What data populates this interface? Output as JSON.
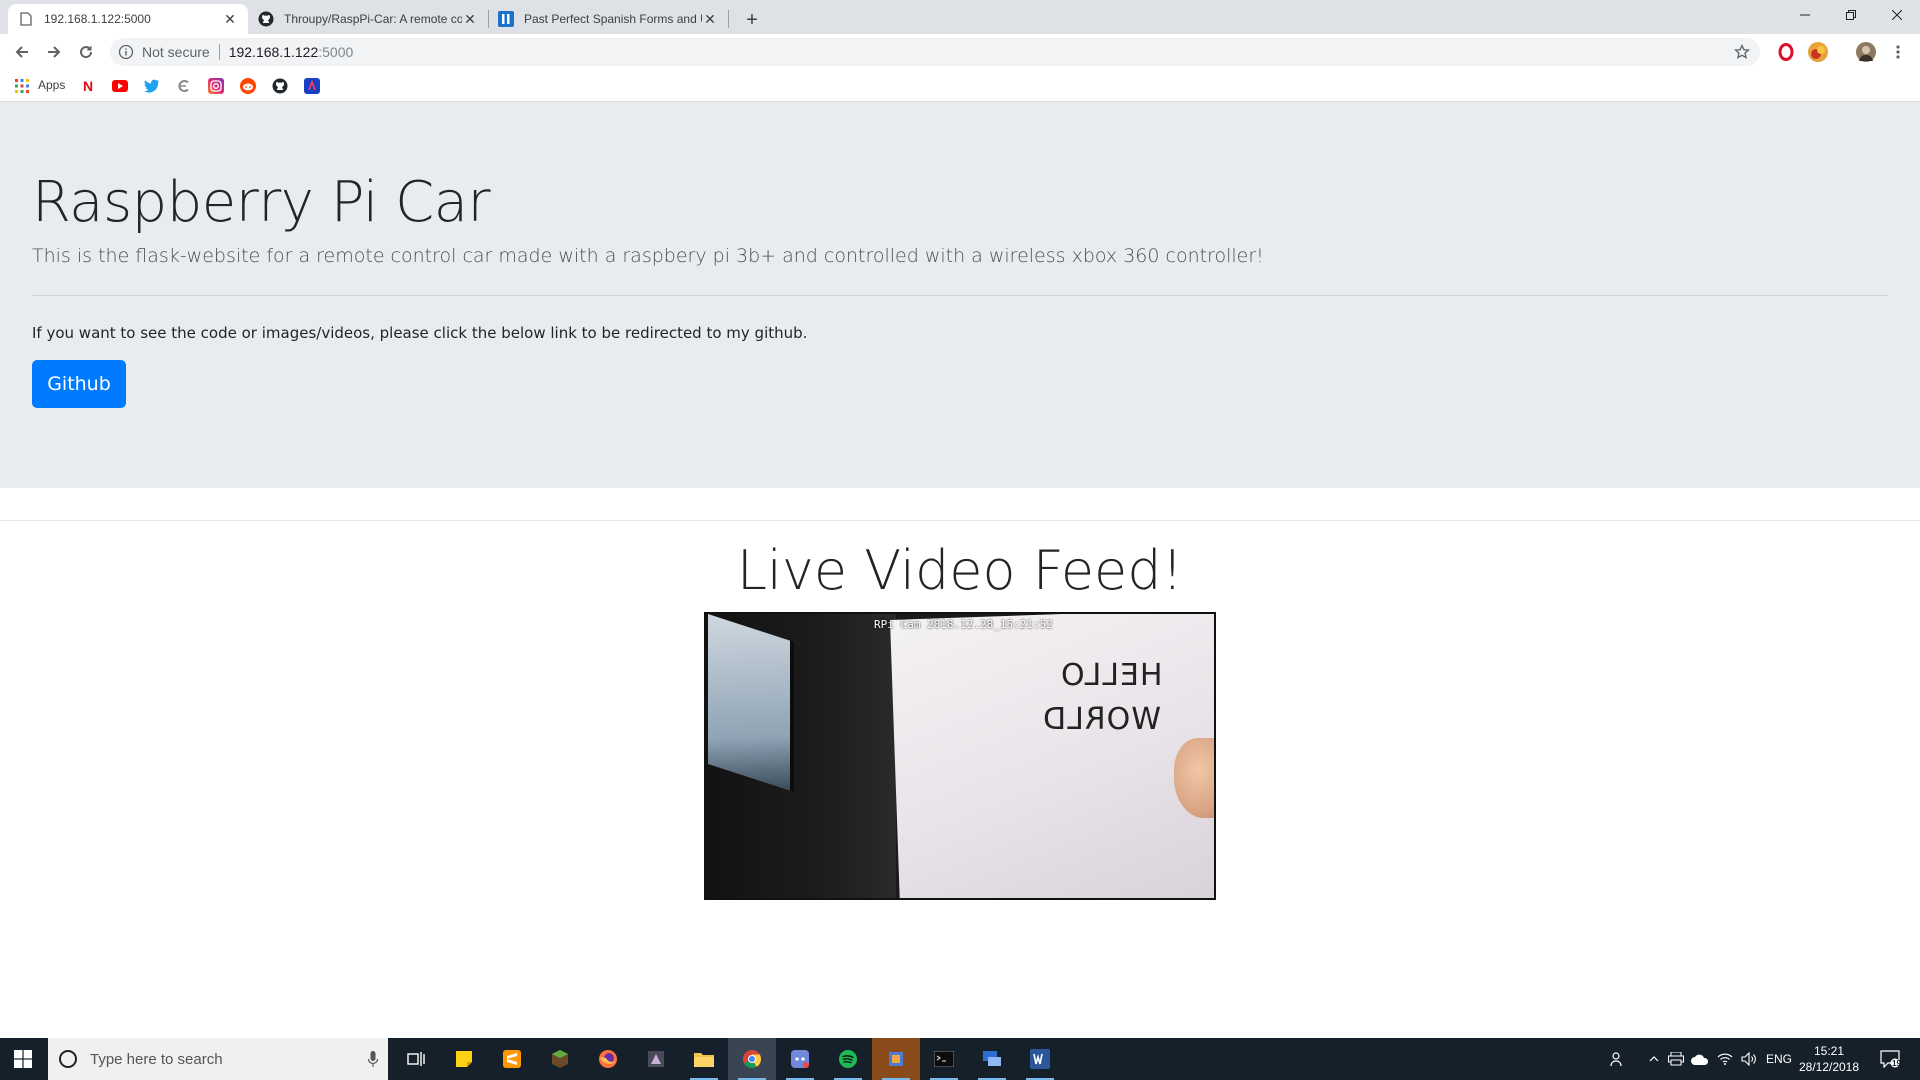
{
  "browser": {
    "tabs": [
      {
        "title": "192.168.1.122:5000",
        "favicon": "page-icon",
        "active": true
      },
      {
        "title": "Throupy/RaspPi-Car: A remote co",
        "favicon": "github-icon",
        "active": false
      },
      {
        "title": "Past Perfect Spanish Forms and U",
        "favicon": "spanishdict-icon",
        "active": false
      }
    ],
    "new_tab": "+",
    "window_controls": {
      "minimize": "—",
      "restore": "❐",
      "close": "✕"
    },
    "address": {
      "security": "Not secure",
      "host": "192.168.1.122",
      "port": ":5000"
    },
    "bookmarks": {
      "apps_label": "Apps",
      "items": [
        "netflix-icon",
        "youtube-icon",
        "twitter-icon",
        "crunchyroll-icon",
        "instagram-icon",
        "reddit-icon",
        "github-icon",
        "bookmark-icon"
      ]
    }
  },
  "page": {
    "title": "Raspberry Pi Car",
    "lead": "This is the flask-website for a remote control car made with a raspbery pi 3b+ and controlled with a wireless xbox 360 controller!",
    "text": "If you want to see the code or images/videos, please click the below link to be redirected to my github.",
    "github_button": "Github",
    "feed_title": "Live Video Feed!",
    "feed": {
      "stamp": "RPi  Cam  2018.12.28_15:21:52",
      "paper_line1": "HELLO",
      "paper_line2": "WORLD"
    }
  },
  "taskbar": {
    "search_placeholder": "Type here to search",
    "language": "ENG",
    "time": "15:21",
    "date": "28/12/2018",
    "notifications": "19"
  },
  "colors": {
    "primary": "#007bff",
    "jumbotron_bg": "#e9ecef",
    "taskbar_bg": "#16202b"
  }
}
